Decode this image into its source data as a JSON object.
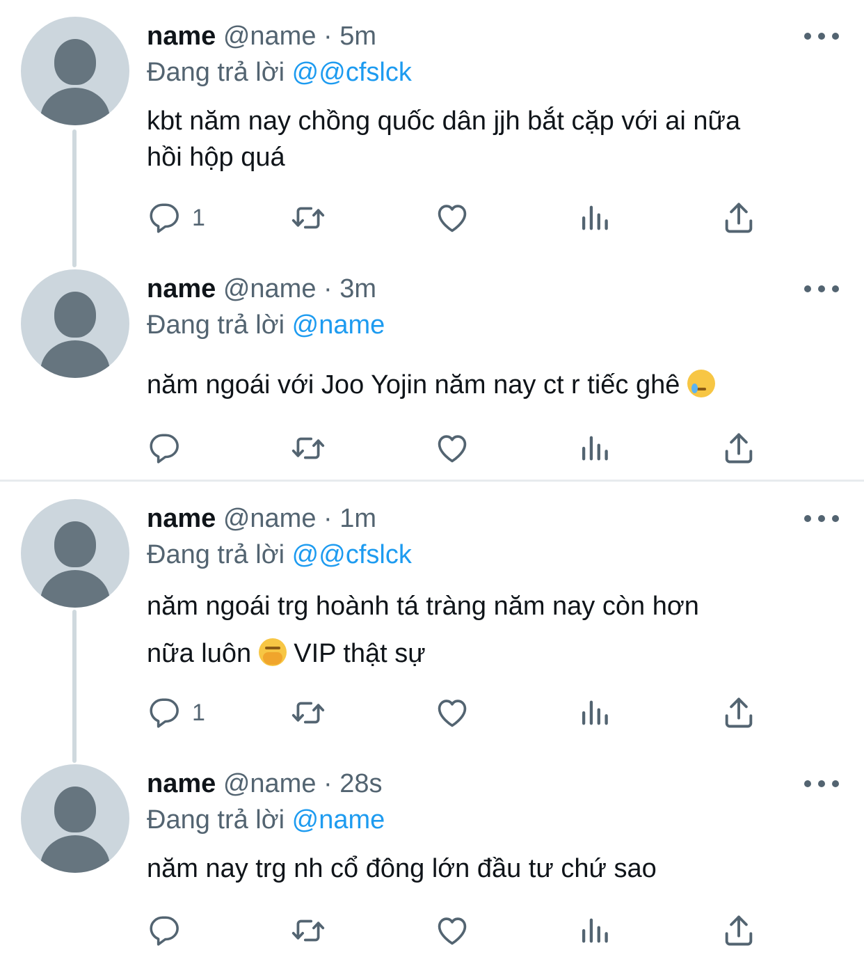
{
  "tweets": [
    {
      "name": "name",
      "meta": "@name · 5m",
      "reply_prefix": "Đang trả lời",
      "reply_handle": "@@cfslck",
      "text_lines": [
        "kbt năm nay chồng quốc dân jjh bắt cặp với ai nữa",
        "hồi hộp quá"
      ],
      "reply_count": "1"
    },
    {
      "name": "name",
      "meta": "@name · 3m",
      "reply_prefix": "Đang trả lời",
      "reply_handle": "@name",
      "text_lines": [
        "năm ngoái với Joo Yojin năm nay ct r tiếc ghê"
      ],
      "emoji": "face-holding-back-tears-emoji",
      "reply_count": ""
    },
    {
      "name": "name",
      "meta": "@name · 1m",
      "reply_prefix": "Đang trả lời",
      "reply_handle": "@@cfslck",
      "text_lines": [
        "năm ngoái trg hoành tá tràng năm nay còn hơn",
        "nữa luôn",
        "VIP thật sự"
      ],
      "emoji": "face-with-hand-over-mouth-emoji",
      "reply_count": "1"
    },
    {
      "name": "name",
      "meta": "@name · 28s",
      "reply_prefix": "Đang trả lời",
      "reply_handle": "@name",
      "text_lines": [
        "năm nay trg nh cổ đông lớn đầu tư chứ sao"
      ],
      "reply_count": ""
    }
  ],
  "icons": {
    "reply": "speech-bubble-icon",
    "retweet": "retweet-icon",
    "like": "heart-icon",
    "views": "bar-chart-icon",
    "share": "share-upload-icon",
    "more": "more-dots-icon"
  },
  "colors": {
    "link": "#1d9bf0",
    "secondary_text": "#536471",
    "avatar_bg": "#ccd6dd",
    "avatar_fg": "#66757f"
  }
}
